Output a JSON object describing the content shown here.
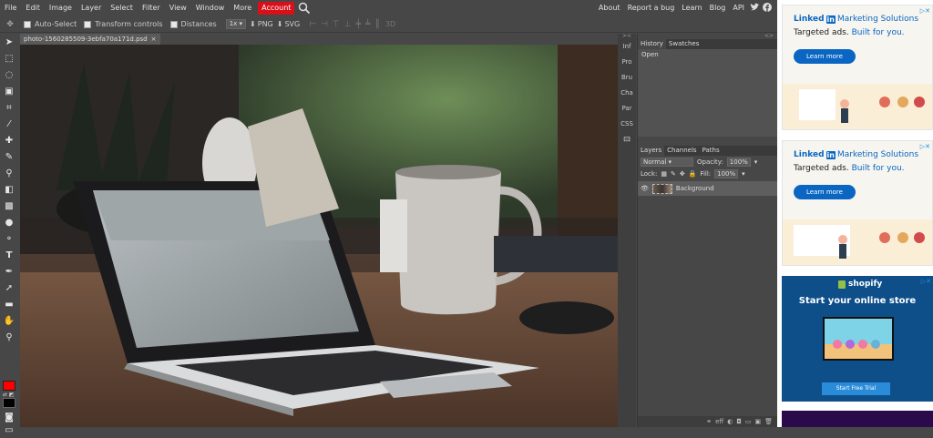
{
  "menubar": {
    "items": [
      "File",
      "Edit",
      "Image",
      "Layer",
      "Select",
      "Filter",
      "View",
      "Window",
      "More"
    ],
    "account": "Account",
    "right_items": [
      "About",
      "Report a bug",
      "Learn",
      "Blog",
      "API"
    ]
  },
  "options": {
    "auto_select": "Auto-Select",
    "transform_controls": "Transform controls",
    "distances": "Distances",
    "zoom": "1x",
    "png": "PNG",
    "svg": "SVG",
    "three_d": "3D"
  },
  "document": {
    "tab_title": "photo-1560285509-3ebfa70a171d.psd",
    "close": "×"
  },
  "mini_panels": [
    "Inf",
    "Pro",
    "Bru",
    "Cha",
    "Par",
    "CSS"
  ],
  "history_panel": {
    "tabs": [
      "History",
      "Swatches"
    ],
    "rows": [
      "Open"
    ]
  },
  "layers_panel": {
    "tabs": [
      "Layers",
      "Channels",
      "Paths"
    ],
    "blend_mode": "Normal",
    "opacity_label": "Opacity:",
    "opacity_value": "100%",
    "lock_label": "Lock:",
    "fill_label": "Fill:",
    "fill_value": "100%",
    "layers": [
      {
        "name": "Background"
      }
    ],
    "footer_eff": "eff"
  },
  "ads": {
    "linkedin": {
      "brand_box": "in",
      "brand_text": "Linked",
      "subtitle": "Marketing Solutions",
      "headline": "Targeted ads.",
      "headline_highlight": "Built for you.",
      "button": "Learn more"
    },
    "shopify": {
      "brand": "shopify",
      "title": "Start your online store",
      "button": "Start Free Trial"
    }
  },
  "colors": {
    "foreground": "#ff0000",
    "background": "#000000",
    "account": "#d9101a",
    "linkedin_blue": "#0a66c2",
    "shopify_bg": "#0e4f8a"
  }
}
